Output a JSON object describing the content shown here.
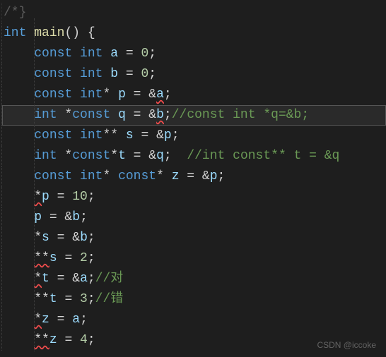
{
  "code": {
    "frag_top": "/*}",
    "l1": {
      "kw1": "int",
      "fn": "main",
      "par": "()",
      "br": " {"
    },
    "l2": {
      "pre": "    ",
      "kw1": "const",
      "kw2": "int",
      "var": "a",
      "eq": " = ",
      "num": "0",
      "end": ";"
    },
    "l3": {
      "pre": "    ",
      "kw1": "const",
      "kw2": "int",
      "var": "b",
      "eq": " = ",
      "num": "0",
      "end": ";"
    },
    "l4": {
      "pre": "    ",
      "kw1": "const",
      "kw2": "int",
      "star": "* ",
      "var": "p",
      "eq": " = &",
      "ref": "a",
      "end": ";"
    },
    "l5": {
      "pre": "    ",
      "kw1": "int",
      "star1": " *",
      "kw2": "const",
      "var": "q",
      "eq": " = &",
      "ref": "b",
      "end": ";",
      "comment": "//const int *q=&b;"
    },
    "l6": {
      "pre": "    ",
      "kw1": "const",
      "kw2": "int",
      "star": "** ",
      "var": "s",
      "eq": " = &",
      "ref": "p",
      "end": ";"
    },
    "l7": {
      "pre": "    ",
      "kw1": "int",
      "star1": " *",
      "kw2": "const",
      "star2": "*",
      "var": "t",
      "eq": " = &",
      "ref": "q",
      "end": "; ",
      "comment": "//int const** t = &q"
    },
    "l8": {
      "pre": "    ",
      "kw1": "const",
      "kw2": "int",
      "star1": "* ",
      "kw3": "const",
      "star2": "* ",
      "var": "z",
      "eq": " = &",
      "ref": "p",
      "end": ";"
    },
    "l9": {
      "pre": "    ",
      "star": "*",
      "var": "p",
      "eq": " = ",
      "num": "10",
      "end": ";"
    },
    "l10": {
      "pre": "    ",
      "var": "p",
      "eq": " = &",
      "ref": "b",
      "end": ";"
    },
    "l11": {
      "pre": "    ",
      "star": "*",
      "var": "s",
      "eq": " = &",
      "ref": "b",
      "end": ";"
    },
    "l12": {
      "pre": "    ",
      "star": "**",
      "var": "s",
      "eq": " = ",
      "num": "2",
      "end": ";"
    },
    "l13": {
      "pre": "    ",
      "star": "*",
      "var": "t",
      "eq": " = &",
      "ref": "a",
      "end": ";",
      "comment": "//对"
    },
    "l14": {
      "pre": "    ",
      "star": "**",
      "var": "t",
      "eq": " = ",
      "num": "3",
      "end": ";",
      "comment": "//错"
    },
    "l15": {
      "pre": "    ",
      "star": "*",
      "var": "z",
      "eq": " = ",
      "ref": "a",
      "end": ";"
    },
    "l16": {
      "pre": "    ",
      "star": "**",
      "var": "z",
      "eq": " = ",
      "num": "4",
      "end": ";"
    }
  },
  "watermark": "CSDN @iccoke"
}
